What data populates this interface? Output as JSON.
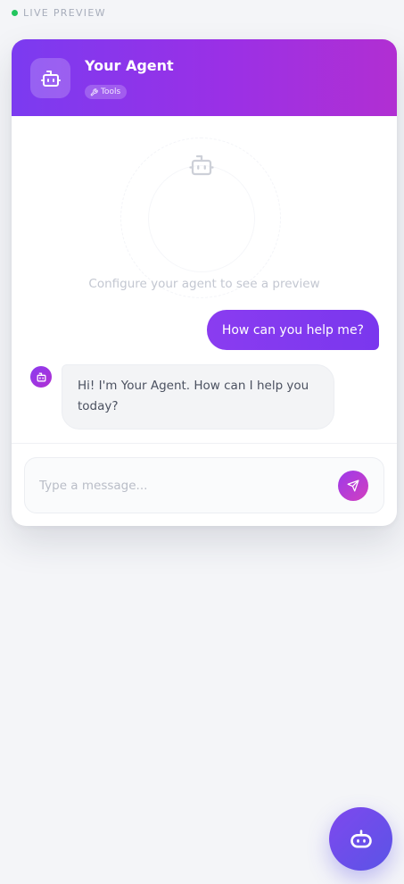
{
  "preview": {
    "status_label": "LIVE PREVIEW",
    "status_color": "#22c55e"
  },
  "agent": {
    "name": "Your Agent",
    "badge_label": "Tools",
    "badge_icon": "wrench-icon",
    "avatar_icon": "robot-icon",
    "header_gradient": [
      "#7b3bf0",
      "#b12fd2"
    ]
  },
  "empty_state": {
    "icon": "robot-icon",
    "text": "Configure your agent to see a preview"
  },
  "messages": [
    {
      "role": "user",
      "text": "How can you help me?"
    },
    {
      "role": "bot",
      "text": "Hi! I'm Your Agent. How can I help you today?"
    }
  ],
  "composer": {
    "placeholder": "Type a message...",
    "value": "",
    "send_icon": "send-icon"
  },
  "launcher": {
    "icon": "robot-icon",
    "color": "#6a4fec"
  }
}
